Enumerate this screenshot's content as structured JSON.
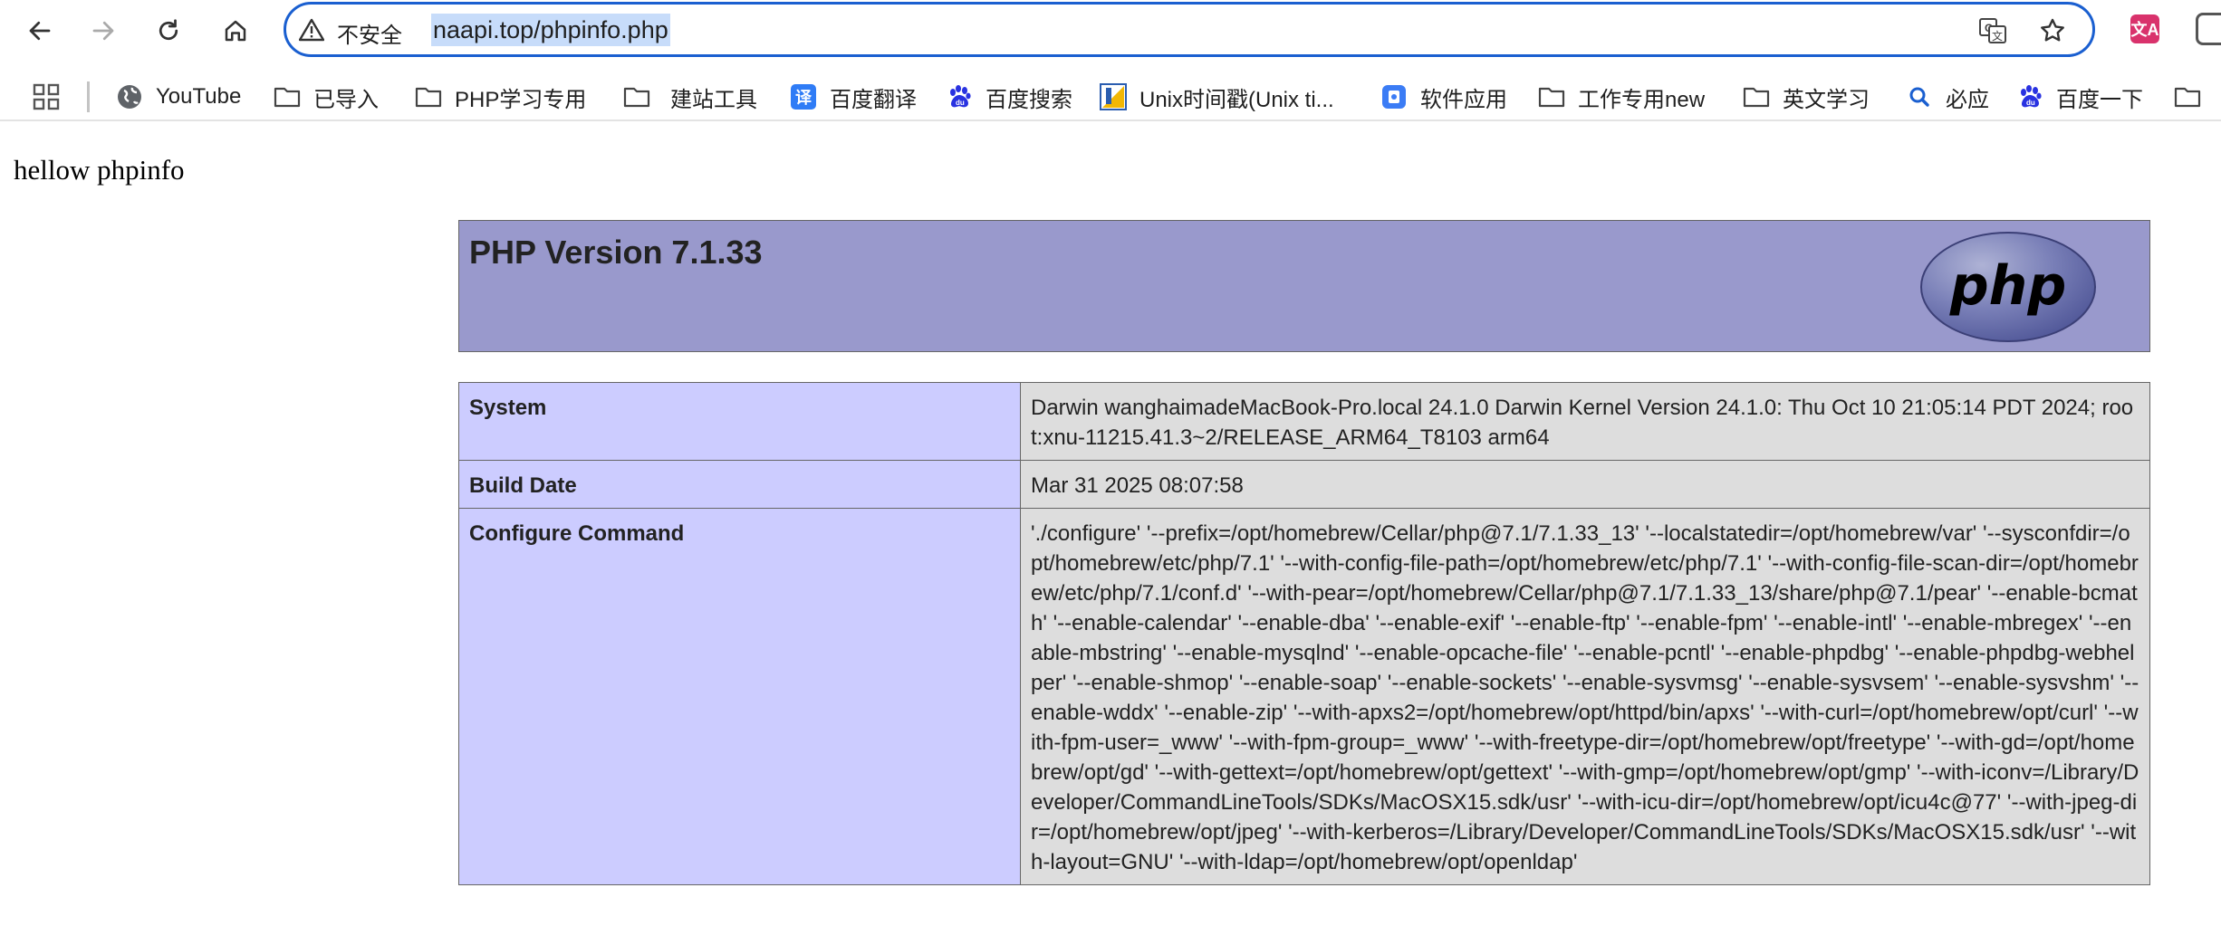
{
  "browser": {
    "security_label": "不安全",
    "url": "naapi.top/phpinfo.php",
    "extension_badge": "文A"
  },
  "bookmarks": [
    {
      "label": "YouTube",
      "icon": "globe-icon"
    },
    {
      "label": "已导入",
      "icon": "folder-icon"
    },
    {
      "label": "PHP学习专用",
      "icon": "folder-icon"
    },
    {
      "label": "建站工具",
      "icon": "folder-icon"
    },
    {
      "label": "百度翻译",
      "icon": "translate-tile-icon",
      "tile_text": "译",
      "color": "#2f7cf6"
    },
    {
      "label": "百度搜索",
      "icon": "baidu-paw-icon",
      "color": "#2932e1"
    },
    {
      "label": "Unix时间戳(Unix ti...",
      "icon": "unix-timestamp-icon"
    },
    {
      "label": "软件应用",
      "icon": "app-tile-icon",
      "color": "#3b7cf5"
    },
    {
      "label": "工作专用new",
      "icon": "folder-icon"
    },
    {
      "label": "英文学习",
      "icon": "folder-icon"
    },
    {
      "label": "必应",
      "icon": "search-icon",
      "color": "#1a5fd0"
    },
    {
      "label": "百度一下",
      "icon": "baidu-paw-icon",
      "color": "#2932e1"
    }
  ],
  "page": {
    "greeting": "hellow phpinfo",
    "php_version_title": "PHP Version 7.1.33",
    "logo_text": "php",
    "rows": [
      {
        "label": "System",
        "value": "Darwin wanghaimadeMacBook-Pro.local 24.1.0 Darwin Kernel Version 24.1.0: Thu Oct 10 21:05:14 PDT 2024; root:xnu-11215.41.3~2/RELEASE_ARM64_T8103 arm64"
      },
      {
        "label": "Build Date",
        "value": "Mar 31 2025 08:07:58"
      },
      {
        "label": "Configure Command",
        "value": "'./configure' '--prefix=/opt/homebrew/Cellar/php@7.1/7.1.33_13' '--localstatedir=/opt/homebrew/var' '--sysconfdir=/opt/homebrew/etc/php/7.1' '--with-config-file-path=/opt/homebrew/etc/php/7.1' '--with-config-file-scan-dir=/opt/homebrew/etc/php/7.1/conf.d' '--with-pear=/opt/homebrew/Cellar/php@7.1/7.1.33_13/share/php@7.1/pear' '--enable-bcmath' '--enable-calendar' '--enable-dba' '--enable-exif' '--enable-ftp' '--enable-fpm' '--enable-intl' '--enable-mbregex' '--enable-mbstring' '--enable-mysqlnd' '--enable-opcache-file' '--enable-pcntl' '--enable-phpdbg' '--enable-phpdbg-webhelper' '--enable-shmop' '--enable-soap' '--enable-sockets' '--enable-sysvmsg' '--enable-sysvsem' '--enable-sysvshm' '--enable-wddx' '--enable-zip' '--with-apxs2=/opt/homebrew/opt/httpd/bin/apxs' '--with-curl=/opt/homebrew/opt/curl' '--with-fpm-user=_www' '--with-fpm-group=_www' '--with-freetype-dir=/opt/homebrew/opt/freetype' '--with-gd=/opt/homebrew/opt/gd' '--with-gettext=/opt/homebrew/opt/gettext' '--with-gmp=/opt/homebrew/opt/gmp' '--with-iconv=/Library/Developer/CommandLineTools/SDKs/MacOSX15.sdk/usr' '--with-icu-dir=/opt/homebrew/opt/icu4c@77' '--with-jpeg-dir=/opt/homebrew/opt/jpeg' '--with-kerberos=/Library/Developer/CommandLineTools/SDKs/MacOSX15.sdk/usr' '--with-layout=GNU' '--with-ldap=/opt/homebrew/opt/openldap'"
      }
    ]
  }
}
